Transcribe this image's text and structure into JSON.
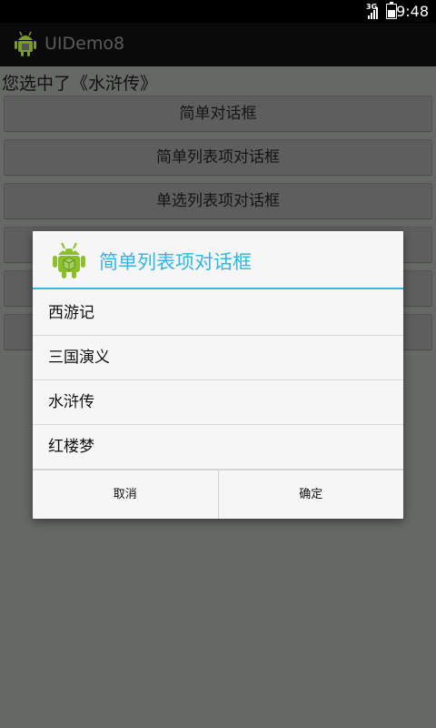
{
  "status_bar": {
    "network": "3G",
    "time": "9:48"
  },
  "action_bar": {
    "app_icon": "android-icon",
    "title": "UIDemo8"
  },
  "main": {
    "selection_text": "您选中了《水浒传》",
    "buttons": [
      {
        "label": "简单对话框"
      },
      {
        "label": "简单列表项对话框"
      },
      {
        "label": "单选列表项对话框"
      },
      {
        "label": ""
      },
      {
        "label": ""
      },
      {
        "label": ""
      }
    ]
  },
  "dialog": {
    "icon": "android-icon",
    "title": "简单列表项对话框",
    "title_color": "#33b5e5",
    "items": [
      {
        "label": "西游记"
      },
      {
        "label": "三国演义"
      },
      {
        "label": "水浒传"
      },
      {
        "label": "红楼梦"
      }
    ],
    "negative_button": "取消",
    "positive_button": "确定"
  }
}
